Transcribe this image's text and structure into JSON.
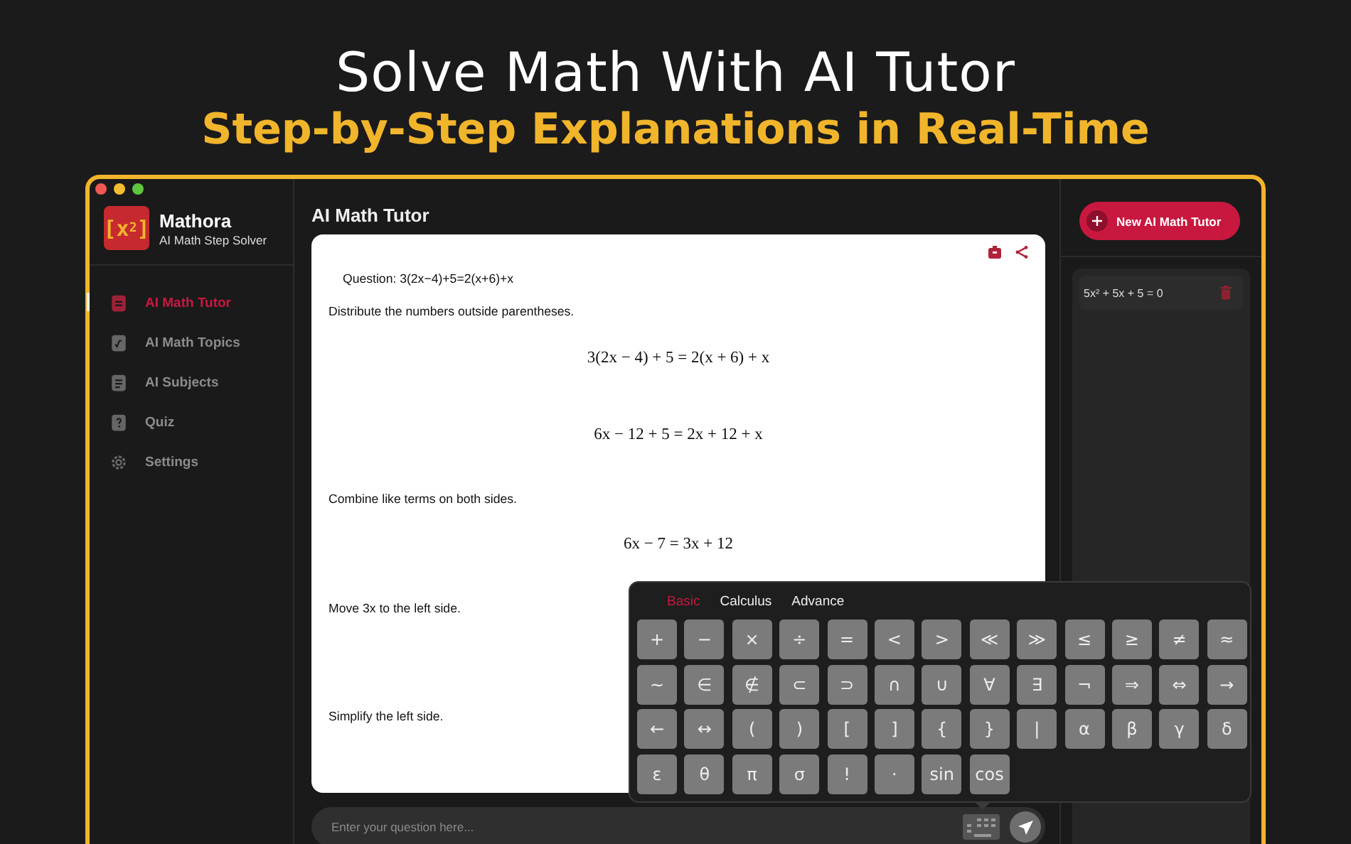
{
  "headline": {
    "title": "Solve Math With AI Tutor",
    "subtitle": "Step-by-Step Explanations in Real-Time"
  },
  "sidebar": {
    "logo": "[x$^{2}$]",
    "app_name": "Mathora",
    "app_tagline": "AI Math Step Solver",
    "nav": [
      {
        "label": "AI Math Tutor",
        "selected": true
      },
      {
        "label": "AI Math Topics",
        "selected": false
      },
      {
        "label": "AI Subjects",
        "selected": false
      },
      {
        "label": "Quiz",
        "selected": false
      },
      {
        "label": "Settings",
        "selected": false
      }
    ]
  },
  "main": {
    "title": "AI Math Tutor",
    "question": "Question: 3(2x−4)+5=2(x+6)+x",
    "steps": [
      {
        "kind": "text",
        "text": "Distribute the numbers outside parentheses."
      },
      {
        "kind": "equation",
        "text": "3(2x − 4) + 5 = 2(x + 6) + x"
      },
      {
        "kind": "equation",
        "text": "6x − 12 + 5 = 2x + 12 + x"
      },
      {
        "kind": "text",
        "text": "Combine like terms on both sides."
      },
      {
        "kind": "equation",
        "text": "6x − 7 = 3x + 12"
      },
      {
        "kind": "text",
        "text": "Move 3x to the left side."
      },
      {
        "kind": "text",
        "text": "Simplify the left side."
      }
    ],
    "input": {
      "placeholder": "Enter your question here..."
    }
  },
  "keypad": {
    "tabs": [
      {
        "label": "Basic",
        "selected": true
      },
      {
        "label": "Calculus",
        "selected": false
      },
      {
        "label": "Advance",
        "selected": false
      }
    ],
    "keys": [
      "+",
      "−",
      "×",
      "÷",
      "=",
      "<",
      ">",
      "≪",
      "≫",
      "≤",
      "≥",
      "≠",
      "≈",
      "~",
      "∈",
      "∉",
      "⊂",
      "⊃",
      "∩",
      "∪",
      "∀",
      "∃",
      "¬",
      "⇒",
      "⇔",
      "→",
      "←",
      "↔",
      "(",
      ")",
      "[",
      "]",
      "{",
      "}",
      "|",
      "α",
      "β",
      "γ",
      "δ",
      "ε",
      "θ",
      "π",
      "σ",
      "!",
      "·",
      "sin",
      "cos"
    ]
  },
  "right_panel": {
    "new_button": "New AI Math Tutor",
    "history": [
      "5x² + 5x + 5 = 0"
    ]
  }
}
